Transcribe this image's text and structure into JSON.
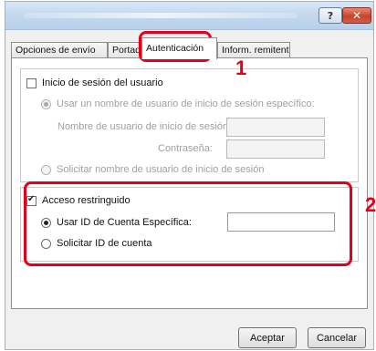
{
  "window": {
    "help_label": "?",
    "close_label": "✕"
  },
  "tabs": [
    {
      "label": "Opciones de envío"
    },
    {
      "label": "Portada"
    },
    {
      "label": "Autenticación"
    },
    {
      "label": "Inform. remitente"
    }
  ],
  "auth": {
    "login_checkbox_label": "Inicio de sesión del usuario",
    "login_checked": false,
    "use_specific_label": "Usar un nombre de usuario de inicio de sesión específico:",
    "username_label": "Nombre de usuario de inicio de sesión:",
    "username_value": "",
    "password_label": "Contraseña:",
    "password_value": "",
    "request_username_label": "Solicitar nombre de usuario de inicio de sesión"
  },
  "restricted": {
    "checkbox_label": "Acceso restringuido",
    "checked": true,
    "use_account_label": "Usar ID de Cuenta Específica:",
    "account_value": "",
    "request_account_label": "Solicitar ID de cuenta"
  },
  "annotations": {
    "step1": "1",
    "step2": "2",
    "color": "#e2001a"
  },
  "buttons": {
    "accept": "Aceptar",
    "cancel": "Cancelar"
  }
}
